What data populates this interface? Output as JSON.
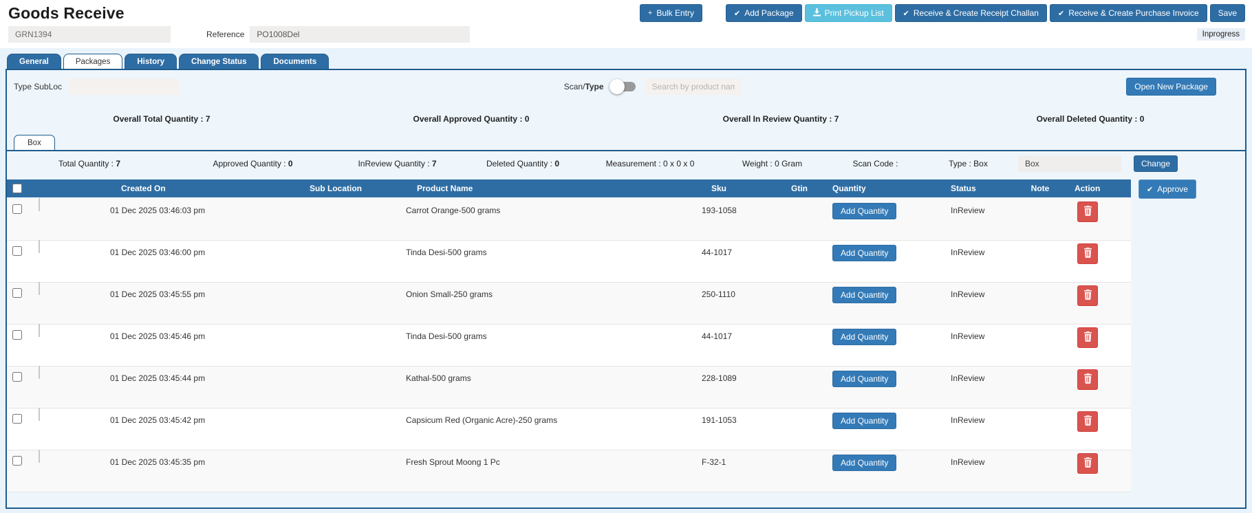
{
  "page": {
    "title": "Goods Receive",
    "status_badge": "Inprogress"
  },
  "toolbar": {
    "bulk_entry": "Bulk Entry",
    "add_package": "Add Package",
    "print_pickup_list": "Print Pickup List",
    "receipt_challan": "Receive & Create Receipt Challan",
    "purchase_invoice": "Receive & Create Purchase Invoice",
    "save": "Save"
  },
  "fields": {
    "grn_value": "GRN1394",
    "reference_label": "Reference",
    "reference_value": "PO1008Del"
  },
  "tabs": [
    {
      "label": "General"
    },
    {
      "label": "Packages"
    },
    {
      "label": "History"
    },
    {
      "label": "Change Status"
    },
    {
      "label": "Documents"
    }
  ],
  "package_panel": {
    "type_subloc_label": "Type SubLoc",
    "scan_label": "Scan/",
    "type_label": "Type",
    "search_placeholder": "Search by product name",
    "open_new_package": "Open New Package",
    "overall": [
      {
        "label": "Overall Total Quantity :",
        "value": "7"
      },
      {
        "label": "Overall Approved Quantity :",
        "value": "0"
      },
      {
        "label": "Overall In Review Quantity :",
        "value": "7"
      },
      {
        "label": "Overall Deleted Quantity :",
        "value": "0"
      }
    ],
    "box_tab": "Box",
    "summary": [
      {
        "label": "Total Quantity :",
        "value": "7"
      },
      {
        "label": "Approved Quantity :",
        "value": "0"
      },
      {
        "label": "InReview Quantity :",
        "value": "7"
      },
      {
        "label": "Deleted Quantity :",
        "value": "0"
      },
      {
        "label": "Measurement :",
        "value": "0 x 0 x 0"
      },
      {
        "label": "Weight :",
        "value": "0 Gram"
      },
      {
        "label": "Scan Code :",
        "value": ""
      },
      {
        "label": "Type :",
        "value": "Box"
      }
    ],
    "type_input_value": "Box",
    "change_button": "Change"
  },
  "table": {
    "headers": [
      "Created On",
      "Sub Location",
      "Product Name",
      "Sku",
      "Gtin",
      "Quantity",
      "Status",
      "Note",
      "Action"
    ],
    "approve_button": "Approve",
    "add_quantity_label": "Add Quantity",
    "rows": [
      {
        "created_on": "01 Dec 2025 03:46:03 pm",
        "sub_location": "",
        "product_name": "Carrot Orange-500 grams",
        "sku": "193-1058",
        "gtin": "",
        "status": "InReview",
        "note": ""
      },
      {
        "created_on": "01 Dec 2025 03:46:00 pm",
        "sub_location": "",
        "product_name": "Tinda Desi-500 grams",
        "sku": "44-1017",
        "gtin": "",
        "status": "InReview",
        "note": ""
      },
      {
        "created_on": "01 Dec 2025 03:45:55 pm",
        "sub_location": "",
        "product_name": "Onion Small-250 grams",
        "sku": "250-1110",
        "gtin": "",
        "status": "InReview",
        "note": ""
      },
      {
        "created_on": "01 Dec 2025 03:45:46 pm",
        "sub_location": "",
        "product_name": "Tinda Desi-500 grams",
        "sku": "44-1017",
        "gtin": "",
        "status": "InReview",
        "note": ""
      },
      {
        "created_on": "01 Dec 2025 03:45:44 pm",
        "sub_location": "",
        "product_name": "Kathal-500 grams",
        "sku": "228-1089",
        "gtin": "",
        "status": "InReview",
        "note": ""
      },
      {
        "created_on": "01 Dec 2025 03:45:42 pm",
        "sub_location": "",
        "product_name": "Capsicum Red (Organic Acre)-250 grams",
        "sku": "191-1053",
        "gtin": "",
        "status": "InReview",
        "note": ""
      },
      {
        "created_on": "01 Dec 2025 03:45:35 pm",
        "sub_location": "",
        "product_name": "Fresh Sprout Moong 1 Pc",
        "sku": "F-32-1",
        "gtin": "",
        "status": "InReview",
        "note": ""
      }
    ]
  },
  "icons": {
    "check": "✔",
    "plus": "+"
  },
  "colors": {
    "primary": "#2e6da4",
    "secondary_button": "#337ab7",
    "info": "#5bc0de",
    "danger": "#d9534f",
    "panel_border": "#1f5c8b",
    "panel_bg": "#e9f3fb",
    "header_bar": "#2e6da4"
  }
}
